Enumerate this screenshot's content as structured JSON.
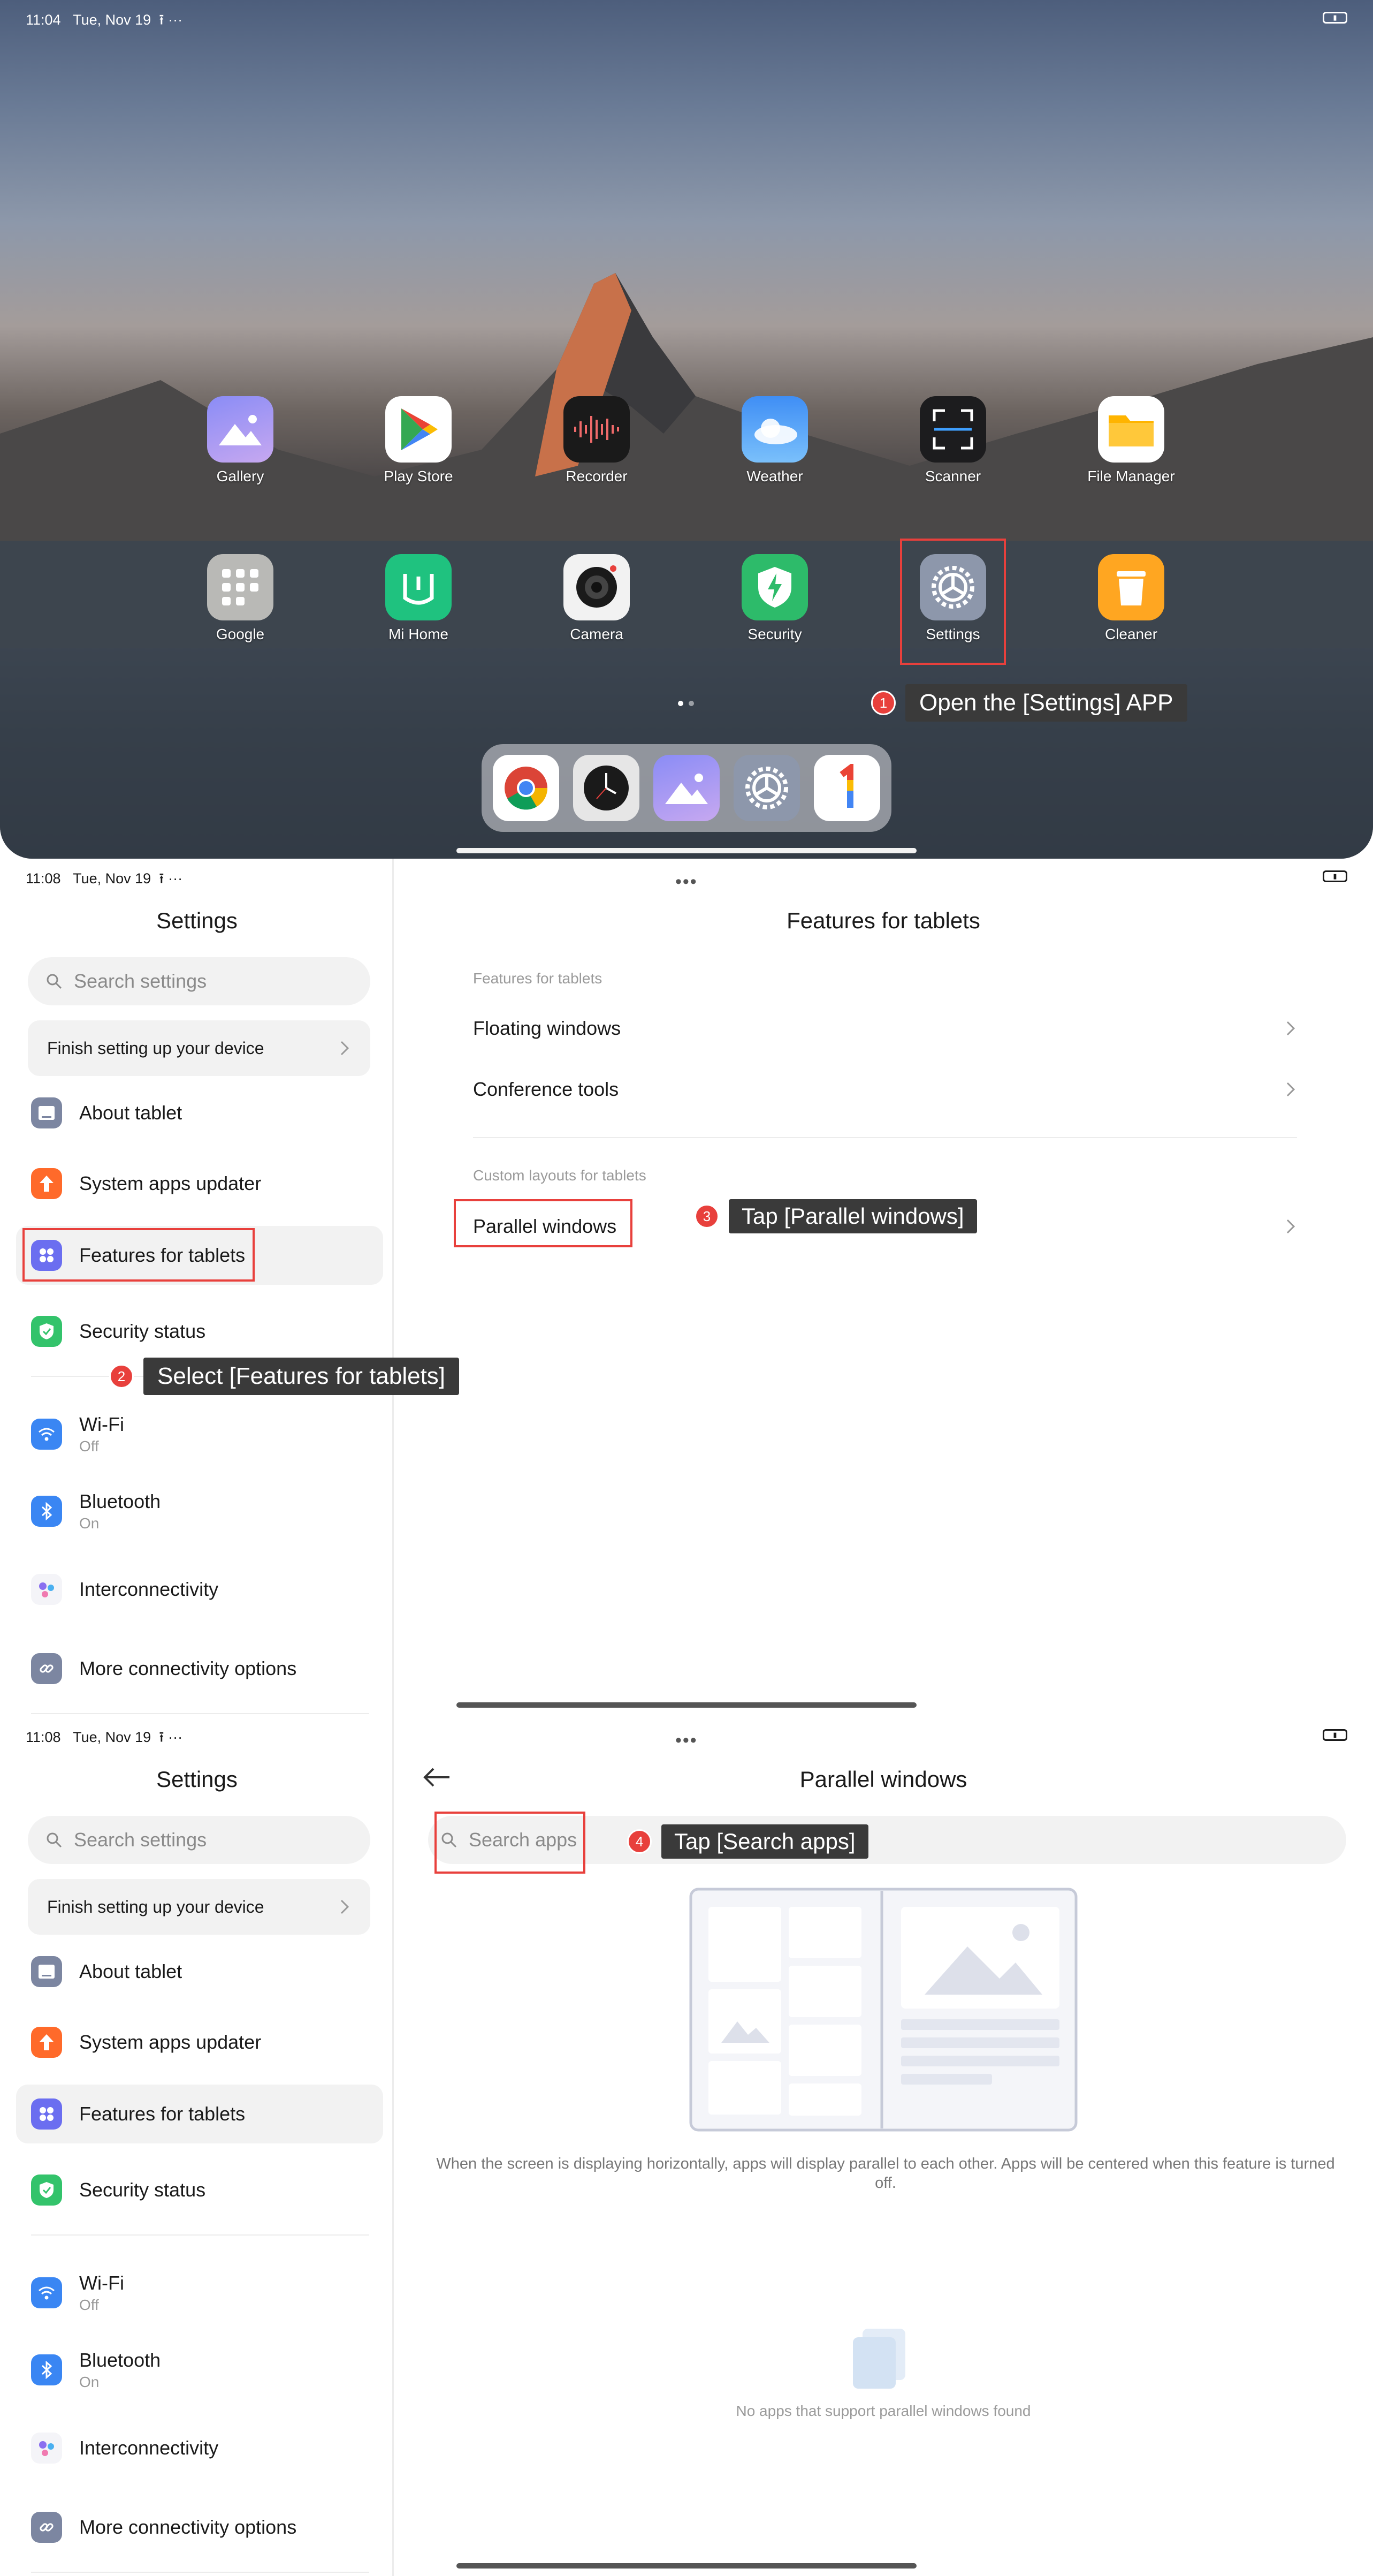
{
  "home": {
    "status": {
      "time": "11:04",
      "date": "Tue, Nov 19",
      "extra": "⭱ ···"
    },
    "apps_row1": [
      "Gallery",
      "Play Store",
      "Recorder",
      "Weather",
      "Scanner",
      "File Manager"
    ],
    "apps_row2": [
      "Google",
      "Mi Home",
      "Camera",
      "Security",
      "Settings",
      "Cleaner"
    ],
    "dock_icons": [
      "chrome-icon",
      "clock-icon",
      "gallery-icon",
      "settings-icon",
      "google-one-icon"
    ],
    "step": {
      "num": "1",
      "text": "Open the [Settings] APP"
    }
  },
  "settings_view1": {
    "status": {
      "time": "11:08",
      "date": "Tue, Nov 19",
      "extra": "⭱ ···"
    },
    "sidebar": {
      "title": "Settings",
      "search_placeholder": "Search settings",
      "finish_setup": "Finish setting up your device",
      "items": [
        {
          "label": "About tablet"
        },
        {
          "label": "System apps updater"
        },
        {
          "label": "Features for tablets"
        },
        {
          "label": "Security status"
        },
        {
          "label": "Wi-Fi",
          "sub": "Off"
        },
        {
          "label": "Bluetooth",
          "sub": "On"
        },
        {
          "label": "Interconnectivity"
        },
        {
          "label": "More connectivity options"
        }
      ]
    },
    "main": {
      "title": "Features for tablets",
      "section1": "Features for tablets",
      "rows1": [
        "Floating windows",
        "Conference tools"
      ],
      "section2": "Custom layouts for tablets",
      "rows2": [
        "Parallel windows"
      ]
    },
    "step2": {
      "num": "2",
      "text": "Select [Features for tablets]"
    },
    "step3": {
      "num": "3",
      "text": "Tap [Parallel windows]"
    }
  },
  "settings_view2": {
    "status": {
      "time": "11:08",
      "date": "Tue, Nov 19",
      "extra": "⭱ ···"
    },
    "main": {
      "title": "Parallel windows",
      "search_placeholder": "Search apps",
      "description": "When the screen is displaying horizontally, apps will display parallel to each other. Apps will be centered when this feature is turned off.",
      "empty_text": "No apps that support parallel windows found"
    },
    "step4": {
      "num": "4",
      "text": "Tap [Search apps]"
    }
  },
  "colors": {
    "highlight": "#e8403c",
    "step_bg": "#3a3a3a",
    "features_icon": "#6b6ef0",
    "updater_icon": "#ff6a2a",
    "security_icon": "#33c36b",
    "wifi_icon": "#3a86f3"
  }
}
